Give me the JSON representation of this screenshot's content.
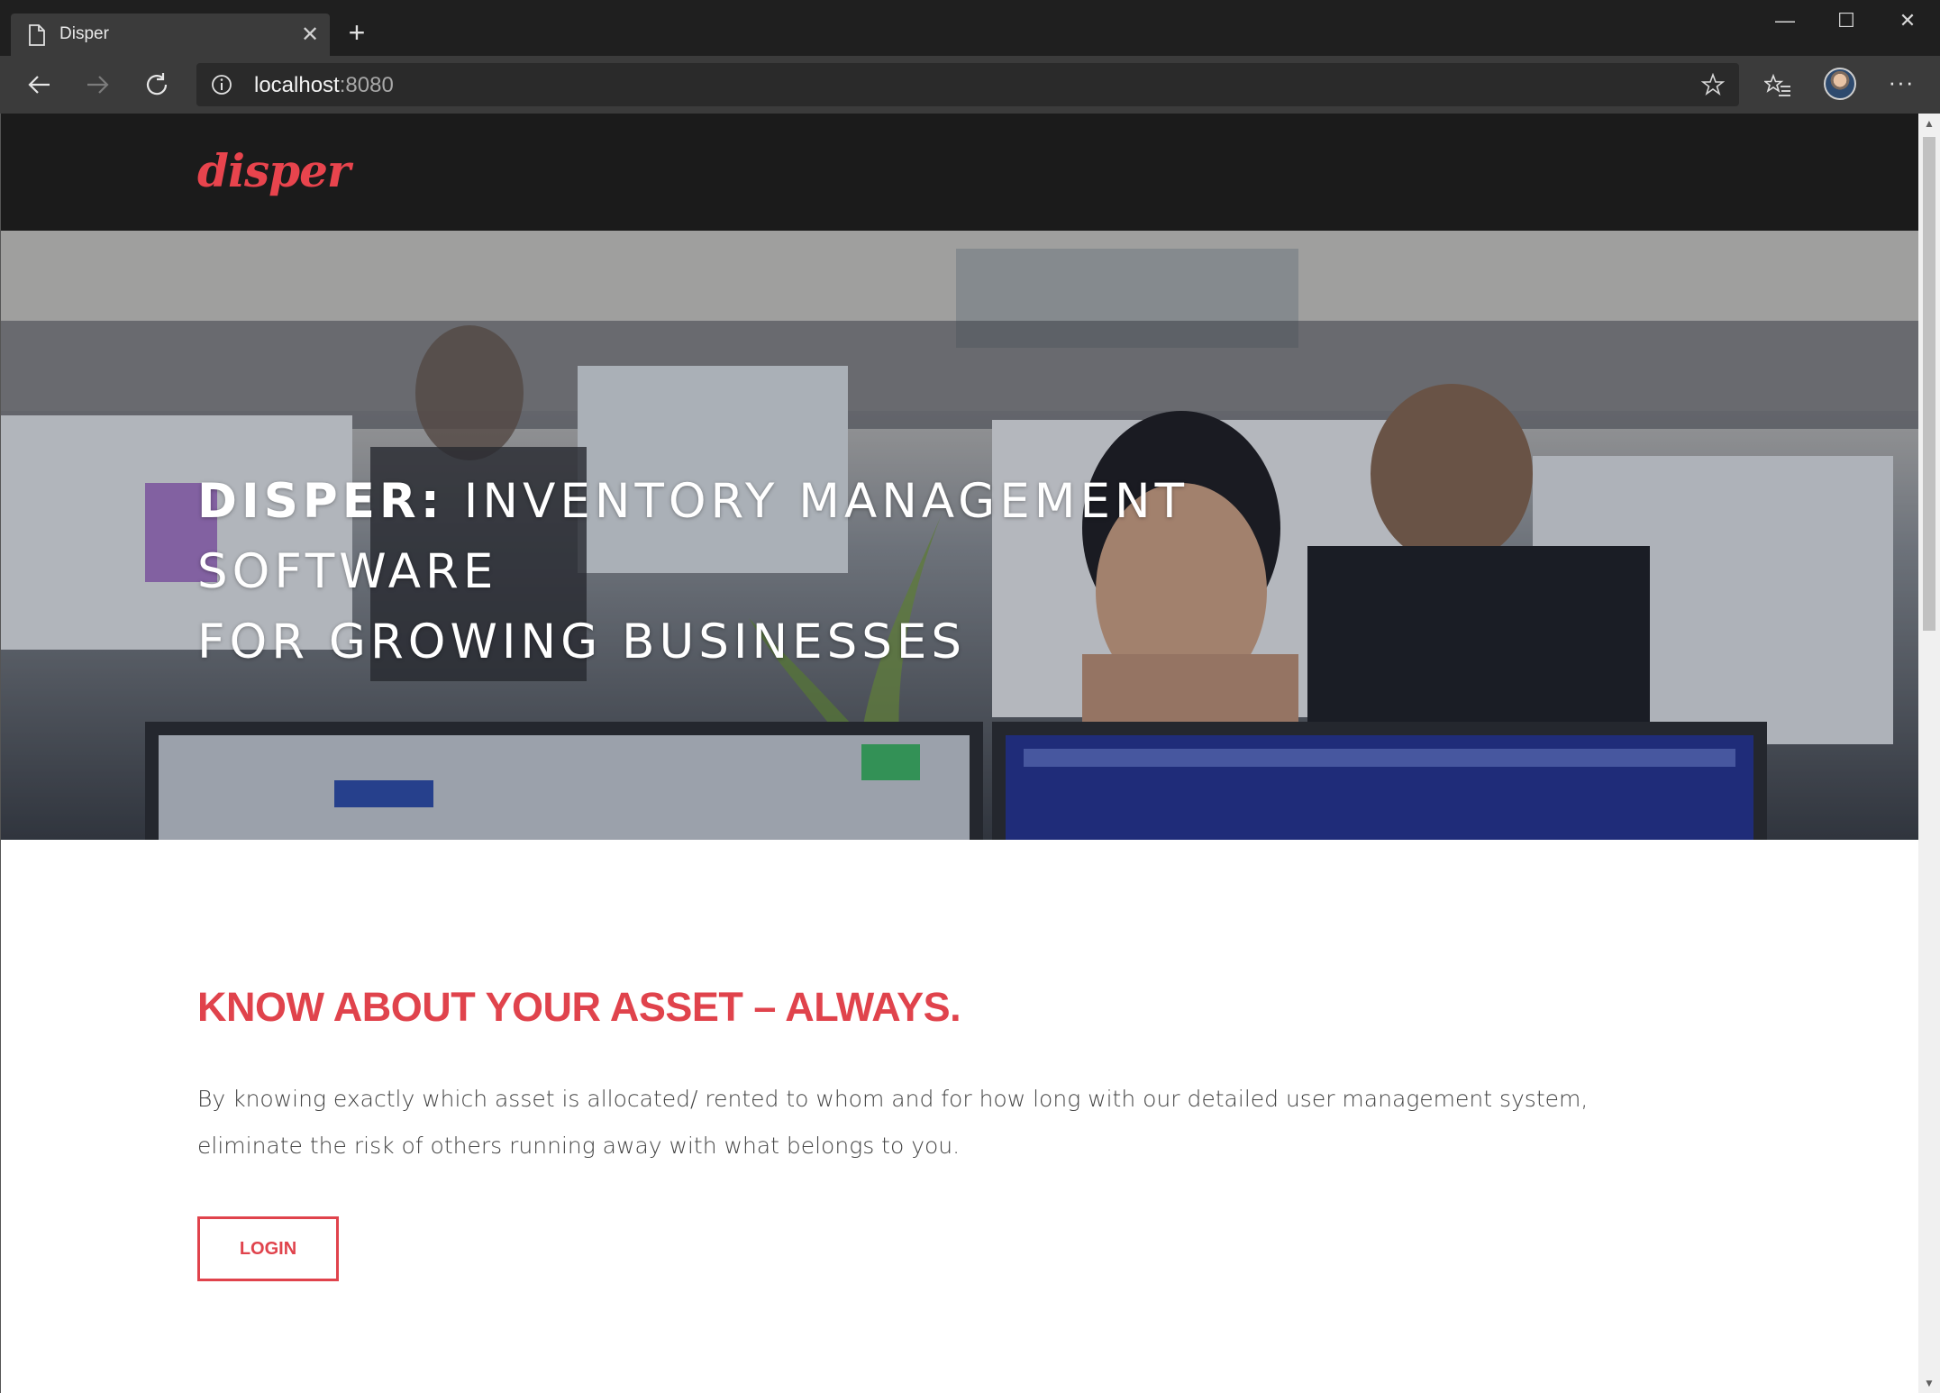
{
  "browser": {
    "tab_title": "Disper",
    "close_tab": "✕",
    "new_tab": "+",
    "url_host": "localhost",
    "url_port": ":8080",
    "more": "···",
    "window_controls": {
      "minimize": "—",
      "maximize": "☐",
      "close": "✕"
    }
  },
  "site": {
    "logo": "disper",
    "hero_brand": "DISPER:",
    "hero_line1": " INVENTORY MANAGEMENT SOFTWARE",
    "hero_line2": "FOR GROWING BUSINESSES",
    "section_title": "KNOW ABOUT YOUR ASSET – ALWAYS.",
    "section_text": "By knowing exactly which asset is allocated/ rented to whom and for how long with our detailed user management system, eliminate the risk of others running away with what belongs to you.",
    "login_label": "LOGIN"
  },
  "colors": {
    "accent": "#e0434c",
    "header_bg": "#1b1b1b",
    "chrome_bg": "#1f1f1f",
    "toolbar_bg": "#3b3b3b"
  },
  "icons": [
    "page-icon",
    "close-icon",
    "plus-icon",
    "back-icon",
    "forward-icon",
    "refresh-icon",
    "info-icon",
    "star-icon",
    "favorites-icon",
    "more-icon"
  ]
}
